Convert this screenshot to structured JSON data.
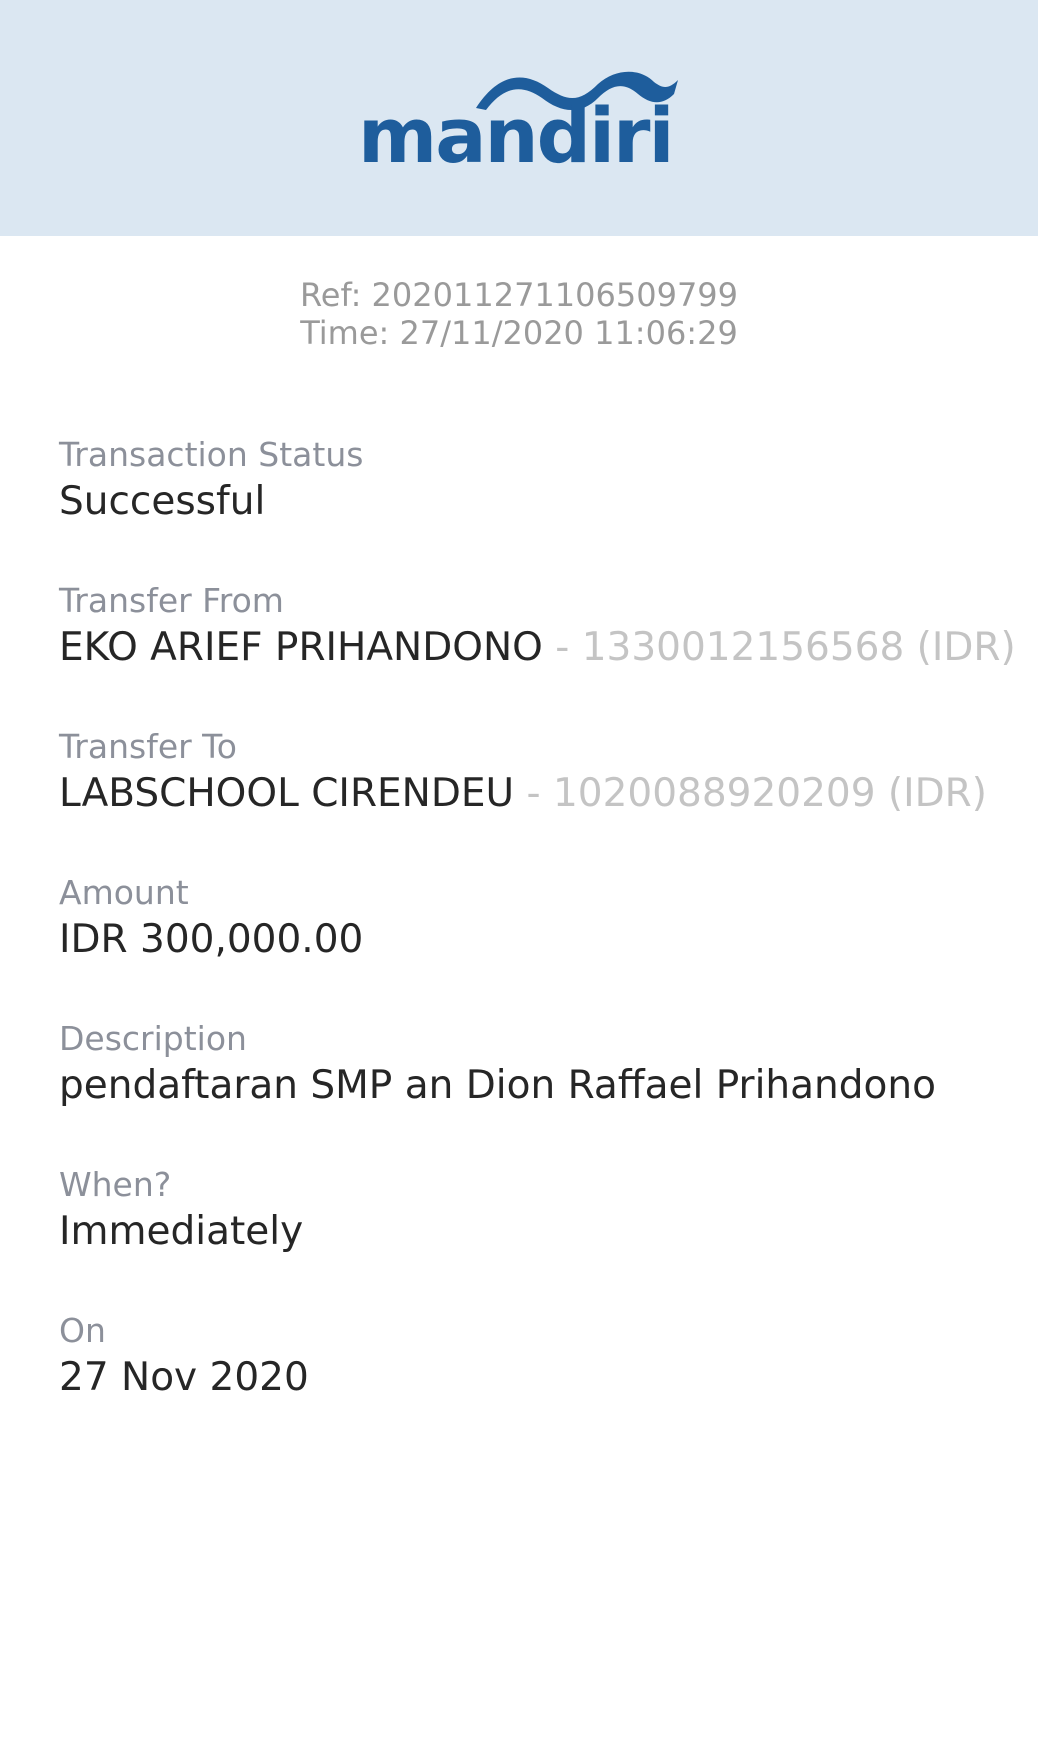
{
  "brand": {
    "logo_text": "mandiri",
    "header_bg": "#dbe7f2",
    "logo_color": "#1e5d9c"
  },
  "receipt": {
    "ref": "Ref: 202011271106509799",
    "time": "Time: 27/11/2020 11:06:29"
  },
  "fields": {
    "status": {
      "label": "Transaction Status",
      "value": "Successful"
    },
    "from": {
      "label": "Transfer From",
      "name": "EKO ARIEF PRIHANDONO",
      "account": " - 1330012156568 (IDR)"
    },
    "to": {
      "label": "Transfer To",
      "name": "LABSCHOOL CIRENDEU",
      "account": " - 1020088920209 (IDR)"
    },
    "amount": {
      "label": "Amount",
      "value": "IDR 300,000.00"
    },
    "description": {
      "label": "Description",
      "value": "pendaftaran SMP an Dion Raffael Prihandono"
    },
    "when": {
      "label": "When?",
      "value": "Immediately"
    },
    "on": {
      "label": "On",
      "value": "27 Nov 2020"
    }
  }
}
